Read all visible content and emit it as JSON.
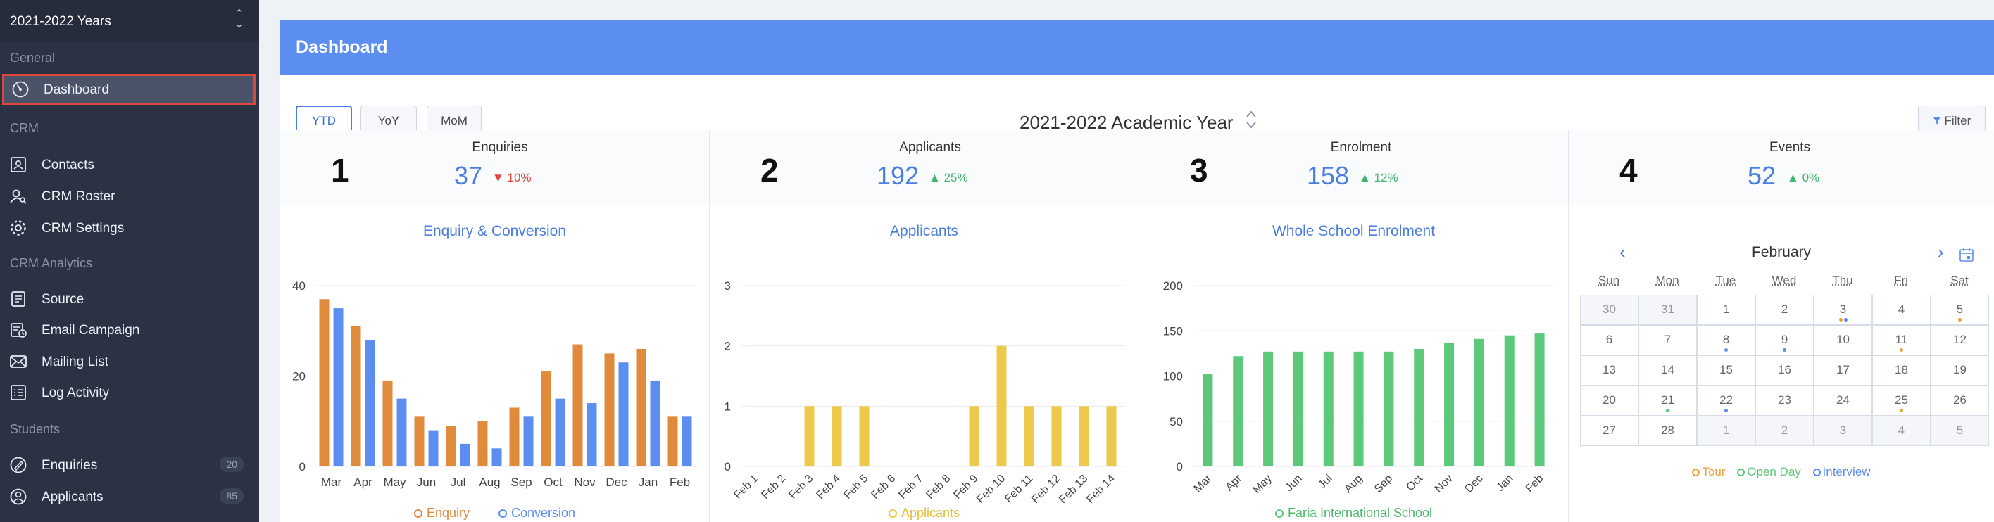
{
  "sidebar": {
    "year": "2021-2022 Years",
    "sections": {
      "general": "General",
      "crm": "CRM",
      "crm_analytics": "CRM Analytics",
      "students": "Students"
    },
    "items": [
      {
        "label": "Dashboard",
        "icon": "dashboard-gauge-icon",
        "active": true
      },
      {
        "label": "Contacts",
        "icon": "contacts-icon"
      },
      {
        "label": "CRM Roster",
        "icon": "roster-icon"
      },
      {
        "label": "CRM Settings",
        "icon": "gear-icon"
      },
      {
        "label": "Source",
        "icon": "source-icon"
      },
      {
        "label": "Email Campaign",
        "icon": "email-campaign-icon"
      },
      {
        "label": "Mailing List",
        "icon": "mail-icon"
      },
      {
        "label": "Log Activity",
        "icon": "log-icon"
      },
      {
        "label": "Enquiries",
        "icon": "enquiries-icon",
        "count": "20"
      },
      {
        "label": "Applicants",
        "icon": "applicants-icon",
        "count": "85"
      }
    ]
  },
  "header": {
    "title": "Dashboard"
  },
  "toolbar": {
    "periods": [
      "YTD",
      "YoY",
      "MoM"
    ],
    "selected_period": "YTD",
    "academic_year": "2021-2022 Academic Year",
    "filter_label": "Filter"
  },
  "stats": [
    {
      "num": "1",
      "name": "Enquiries",
      "value": "37",
      "delta": "10%",
      "direction": "down"
    },
    {
      "num": "2",
      "name": "Applicants",
      "value": "192",
      "delta": "25%",
      "direction": "up"
    },
    {
      "num": "3",
      "name": "Enrolment",
      "value": "158",
      "delta": "12%",
      "direction": "up"
    },
    {
      "num": "4",
      "name": "Events",
      "value": "52",
      "delta": "0%",
      "direction": "up"
    }
  ],
  "colors": {
    "accent": "#5c8ef0",
    "enquiry": "#e08a3c",
    "conversion": "#5b8ef0",
    "applicants": "#ecc94b",
    "enrolment": "#5cc97a",
    "up": "#3fb66a",
    "down": "#e0473a"
  },
  "chart_data": [
    {
      "type": "bar",
      "title": "Enquiry & Conversion",
      "categories": [
        "Mar",
        "Apr",
        "May",
        "Jun",
        "Jul",
        "Aug",
        "Sep",
        "Oct",
        "Nov",
        "Dec",
        "Jan",
        "Feb"
      ],
      "series": [
        {
          "name": "Enquiry",
          "values": [
            37,
            31,
            19,
            11,
            9,
            10,
            13,
            21,
            27,
            25,
            26,
            11
          ]
        },
        {
          "name": "Conversion",
          "values": [
            35,
            28,
            15,
            8,
            5,
            4,
            11,
            15,
            14,
            23,
            19,
            11
          ]
        }
      ],
      "ylim": [
        0,
        40
      ],
      "yticks": [
        0,
        20,
        40
      ],
      "grid": true,
      "legend": "bottom"
    },
    {
      "type": "bar",
      "title": "Applicants",
      "categories": [
        "Feb 1",
        "Feb 2",
        "Feb 3",
        "Feb 4",
        "Feb 5",
        "Feb 6",
        "Feb 7",
        "Feb 8",
        "Feb 9",
        "Feb 10",
        "Feb 11",
        "Feb 12",
        "Feb 13",
        "Feb 14"
      ],
      "series": [
        {
          "name": "Applicants",
          "values": [
            0,
            0,
            1,
            1,
            1,
            0,
            0,
            0,
            1,
            2,
            1,
            1,
            1,
            1
          ]
        }
      ],
      "ylim": [
        0,
        3
      ],
      "yticks": [
        0,
        1,
        2,
        3
      ],
      "grid": true,
      "legend": "bottom"
    },
    {
      "type": "bar",
      "title": "Whole School Enrolment",
      "categories": [
        "Mar",
        "Apr",
        "May",
        "Jun",
        "Jul",
        "Aug",
        "Sep",
        "Oct",
        "Nov",
        "Dec",
        "Jan",
        "Feb"
      ],
      "series": [
        {
          "name": "Faria International School",
          "values": [
            102,
            122,
            127,
            127,
            127,
            127,
            127,
            130,
            137,
            141,
            145,
            147
          ]
        }
      ],
      "ylim": [
        0,
        200
      ],
      "yticks": [
        0,
        50,
        100,
        150,
        200
      ],
      "grid": true,
      "legend": "bottom"
    }
  ],
  "calendar": {
    "month": "February",
    "weekdays": [
      "Sun",
      "Mon",
      "Tue",
      "Wed",
      "Thu",
      "Fri",
      "Sat"
    ],
    "weeks": [
      [
        {
          "d": "30",
          "m": true
        },
        {
          "d": "31",
          "m": true
        },
        {
          "d": "1"
        },
        {
          "d": "2"
        },
        {
          "d": "3",
          "dots": [
            "tour",
            "interview"
          ]
        },
        {
          "d": "4"
        },
        {
          "d": "5",
          "dots": [
            "tour"
          ]
        }
      ],
      [
        {
          "d": "6"
        },
        {
          "d": "7"
        },
        {
          "d": "8",
          "dots": [
            "interview"
          ]
        },
        {
          "d": "9",
          "dots": [
            "interview"
          ]
        },
        {
          "d": "10"
        },
        {
          "d": "11",
          "dots": [
            "tour"
          ]
        },
        {
          "d": "12"
        }
      ],
      [
        {
          "d": "13"
        },
        {
          "d": "14"
        },
        {
          "d": "15"
        },
        {
          "d": "16"
        },
        {
          "d": "17"
        },
        {
          "d": "18"
        },
        {
          "d": "19"
        }
      ],
      [
        {
          "d": "20"
        },
        {
          "d": "21",
          "dots": [
            "openday"
          ]
        },
        {
          "d": "22",
          "dots": [
            "interview"
          ]
        },
        {
          "d": "23"
        },
        {
          "d": "24"
        },
        {
          "d": "25",
          "dots": [
            "tour"
          ]
        },
        {
          "d": "26"
        }
      ],
      [
        {
          "d": "27"
        },
        {
          "d": "28"
        },
        {
          "d": "1",
          "m": true
        },
        {
          "d": "2",
          "m": true
        },
        {
          "d": "3",
          "m": true
        },
        {
          "d": "4",
          "m": true
        },
        {
          "d": "5",
          "m": true
        }
      ]
    ],
    "legend": [
      {
        "label": "Tour",
        "key": "tour",
        "color": "#e8a03a"
      },
      {
        "label": "Open Day",
        "key": "openday",
        "color": "#5cc97a"
      },
      {
        "label": "Interview",
        "key": "interview",
        "color": "#5b8ef0"
      }
    ]
  }
}
